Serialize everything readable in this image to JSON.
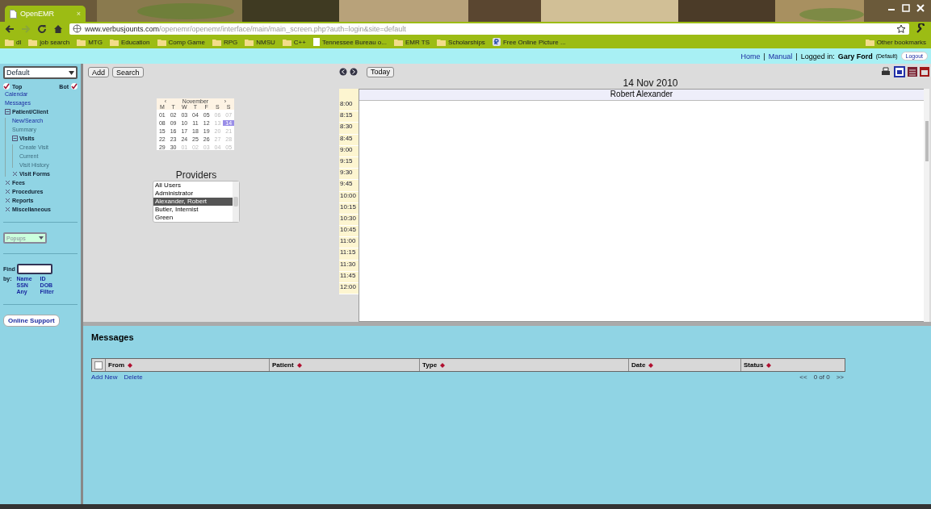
{
  "browser": {
    "tab": {
      "title": "OpenEMR",
      "close": "×"
    },
    "address": {
      "host": "www.verbusjounts.com",
      "path": "/openemr/openemr/interface/main/main_screen.php?auth=login&site=default"
    },
    "bookmarks": [
      {
        "label": "dl",
        "kind": "folder"
      },
      {
        "label": "job search",
        "kind": "folder"
      },
      {
        "label": "MTG",
        "kind": "folder"
      },
      {
        "label": "Education",
        "kind": "folder"
      },
      {
        "label": "Comp Game",
        "kind": "folder"
      },
      {
        "label": "RPG",
        "kind": "folder"
      },
      {
        "label": "NMSU",
        "kind": "folder"
      },
      {
        "label": "C++",
        "kind": "folder"
      },
      {
        "label": "Tennessee Bureau o...",
        "kind": "page"
      },
      {
        "label": "EMR TS",
        "kind": "folder"
      },
      {
        "label": "Scholarships",
        "kind": "folder"
      },
      {
        "label": "Free Online Picture ...",
        "kind": "site"
      }
    ],
    "other_bookmarks": "Other bookmarks"
  },
  "header": {
    "links": [
      "Home",
      "Manual"
    ],
    "separator": "|",
    "logged_in_label": "Logged in:",
    "user": "Gary Ford",
    "user_note": "(Default)",
    "logout": "Logout"
  },
  "sidebar": {
    "layout_select": "Default",
    "top": {
      "label": "Top",
      "checked": true
    },
    "bot": {
      "label": "Bot",
      "checked": true
    },
    "tree": [
      {
        "label": "Calendar"
      },
      {
        "label": "Messages"
      },
      {
        "label": "Patient/Client",
        "expanded": true,
        "children": [
          {
            "label": "New/Search",
            "enabled": true
          },
          {
            "label": "Summary",
            "enabled": false
          },
          {
            "label": "Visits",
            "expanded": true,
            "children": [
              {
                "label": "Create Visit",
                "enabled": false
              },
              {
                "label": "Current",
                "enabled": false
              },
              {
                "label": "Visit History",
                "enabled": false
              }
            ]
          },
          {
            "label": "Visit Forms",
            "expanded": false
          }
        ]
      },
      {
        "label": "Fees",
        "expanded": false
      },
      {
        "label": "Procedures",
        "expanded": false
      },
      {
        "label": "Reports",
        "expanded": false
      },
      {
        "label": "Miscellaneous",
        "expanded": false
      }
    ],
    "popups_select": "Popups",
    "find_label": "Find",
    "by_label": "by:",
    "find_links": [
      "Name",
      "ID",
      "SSN",
      "DOB",
      "Any",
      "Filter"
    ],
    "support_button": "Online Support"
  },
  "toolbar": {
    "buttons": [
      "Add",
      "Search"
    ],
    "today": "Today"
  },
  "mini_calendar": {
    "prev": "‹",
    "month": "November",
    "next": "›",
    "weekdays": [
      "M",
      "T",
      "W",
      "T",
      "F",
      "S",
      "S"
    ],
    "days": [
      {
        "d": "01",
        "muted": false,
        "selected": false
      },
      {
        "d": "02",
        "muted": false,
        "selected": false
      },
      {
        "d": "03",
        "muted": false,
        "selected": false
      },
      {
        "d": "04",
        "muted": false,
        "selected": false
      },
      {
        "d": "05",
        "muted": false,
        "selected": false
      },
      {
        "d": "06",
        "muted": true,
        "selected": false
      },
      {
        "d": "07",
        "muted": true,
        "selected": false
      },
      {
        "d": "08",
        "muted": false,
        "selected": false
      },
      {
        "d": "09",
        "muted": false,
        "selected": false
      },
      {
        "d": "10",
        "muted": false,
        "selected": false
      },
      {
        "d": "11",
        "muted": false,
        "selected": false
      },
      {
        "d": "12",
        "muted": false,
        "selected": false
      },
      {
        "d": "13",
        "muted": true,
        "selected": false
      },
      {
        "d": "14",
        "muted": false,
        "selected": true
      },
      {
        "d": "15",
        "muted": false,
        "selected": false
      },
      {
        "d": "16",
        "muted": false,
        "selected": false
      },
      {
        "d": "17",
        "muted": false,
        "selected": false
      },
      {
        "d": "18",
        "muted": false,
        "selected": false
      },
      {
        "d": "19",
        "muted": false,
        "selected": false
      },
      {
        "d": "20",
        "muted": true,
        "selected": false
      },
      {
        "d": "21",
        "muted": true,
        "selected": false
      },
      {
        "d": "22",
        "muted": false,
        "selected": false
      },
      {
        "d": "23",
        "muted": false,
        "selected": false
      },
      {
        "d": "24",
        "muted": false,
        "selected": false
      },
      {
        "d": "25",
        "muted": false,
        "selected": false
      },
      {
        "d": "26",
        "muted": false,
        "selected": false
      },
      {
        "d": "27",
        "muted": true,
        "selected": false
      },
      {
        "d": "28",
        "muted": true,
        "selected": false
      },
      {
        "d": "29",
        "muted": false,
        "selected": false
      },
      {
        "d": "30",
        "muted": false,
        "selected": false
      },
      {
        "d": "01",
        "muted": true,
        "selected": false
      },
      {
        "d": "02",
        "muted": true,
        "selected": false
      },
      {
        "d": "03",
        "muted": true,
        "selected": false
      },
      {
        "d": "04",
        "muted": true,
        "selected": false
      },
      {
        "d": "05",
        "muted": true,
        "selected": false
      }
    ]
  },
  "providers": {
    "title": "Providers",
    "items": [
      {
        "label": "All Users",
        "selected": false
      },
      {
        "label": "Administrator",
        "selected": false
      },
      {
        "label": "Alexander, Robert",
        "selected": true
      },
      {
        "label": "Butler, Internist",
        "selected": false
      },
      {
        "label": "Green",
        "selected": false
      }
    ]
  },
  "day_view": {
    "date": "14 Nov 2010",
    "provider": "Robert Alexander",
    "times": [
      "8:00",
      "8:15",
      "8:30",
      "8:45",
      "9:00",
      "9:15",
      "9:30",
      "9:45",
      "10:00",
      "10:15",
      "10:30",
      "10:45",
      "11:00",
      "11:15",
      "11:30",
      "11:45",
      "12:00"
    ]
  },
  "messages": {
    "title": "Messages",
    "select_all_checked": false,
    "columns": [
      "From",
      "Patient",
      "Type",
      "Date",
      "Status"
    ],
    "actions": [
      "Add New",
      "Delete"
    ],
    "pager": {
      "prev": "<<",
      "count": "0 of 0",
      "next": ">>"
    }
  }
}
